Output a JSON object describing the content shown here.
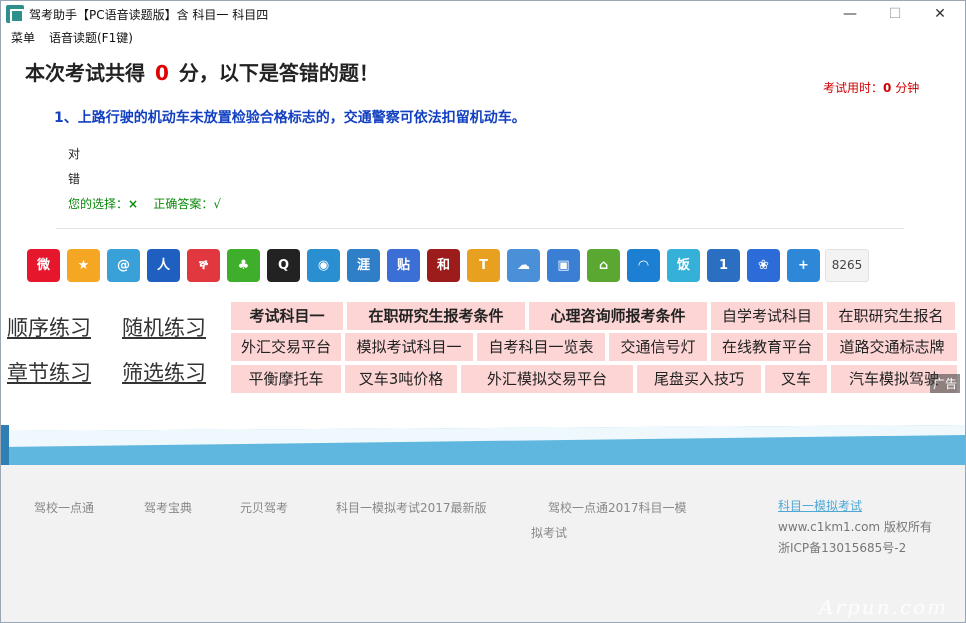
{
  "window": {
    "title": "驾考助手【PC语音读题版】含 科目一 科目四",
    "minimize": "—",
    "maximize": "☐",
    "close": "✕"
  },
  "menu": {
    "items": [
      "菜单",
      "语音读题(F1键)"
    ]
  },
  "result": {
    "heading_pre": "本次考试共得",
    "score": "0",
    "heading_post": "分，以下是答错的题！",
    "timer_label": "考试用时：",
    "timer_value": "0",
    "timer_unit": "分钟"
  },
  "question": {
    "text": "1、上路行驶的机动车未放置检验合格标志的，交通警察可依法扣留机动车。",
    "options": [
      "对",
      "错"
    ],
    "your_choice_label": "您的选择：",
    "your_choice": "×",
    "correct_label": "正确答案：",
    "correct": "√"
  },
  "share": {
    "icons": [
      {
        "name": "weibo-icon",
        "glyph": "微",
        "color": "#e6162d"
      },
      {
        "name": "qzone-icon",
        "glyph": "★",
        "color": "#f5a623"
      },
      {
        "name": "tencent-weibo-icon",
        "glyph": "@",
        "color": "#3aa0d8"
      },
      {
        "name": "renren-icon",
        "glyph": "人",
        "color": "#1f5fbf"
      },
      {
        "name": "douban-icon",
        "glyph": "ኞ",
        "color": "#e0383e"
      },
      {
        "name": "kaixin-icon",
        "glyph": "♣",
        "color": "#3fae2a"
      },
      {
        "name": "qq-icon",
        "glyph": "Q",
        "color": "#222222"
      },
      {
        "name": "tianya-icon",
        "glyph": "◉",
        "color": "#2a8fd1"
      },
      {
        "name": "sohu-icon",
        "glyph": "涯",
        "color": "#2f7fc8"
      },
      {
        "name": "tieba-icon",
        "glyph": "贴",
        "color": "#3b6fd6"
      },
      {
        "name": "hexun-icon",
        "glyph": "和",
        "color": "#9c1c1c"
      },
      {
        "name": "toutiao-icon",
        "glyph": "T",
        "color": "#e8a020"
      },
      {
        "name": "cloud-icon",
        "glyph": "☁",
        "color": "#4a90d9"
      },
      {
        "name": "gallery-icon",
        "glyph": "▣",
        "color": "#3a7fd4"
      },
      {
        "name": "house-icon",
        "glyph": "⌂",
        "color": "#5aa832"
      },
      {
        "name": "wifi-icon",
        "glyph": "◠",
        "color": "#1d7fd1"
      },
      {
        "name": "fanfou-icon",
        "glyph": "饭",
        "color": "#35b0d9"
      },
      {
        "name": "number-one-icon",
        "glyph": "1",
        "color": "#2a6fc1"
      },
      {
        "name": "paw-icon",
        "glyph": "❀",
        "color": "#2b6cd8"
      },
      {
        "name": "more-plus-icon",
        "glyph": "+",
        "color": "#2f87d8"
      }
    ],
    "count": "8265"
  },
  "practice": {
    "items": [
      "顺序练习",
      "随机练习",
      "章节练习",
      "筛选练习"
    ]
  },
  "ad_links": {
    "rows": [
      [
        "考试科目一",
        "在职研究生报考条件",
        "心理咨询师报考条件",
        "自学考试科目",
        "在职研究生报名"
      ],
      [
        "外汇交易平台",
        "模拟考试科目一",
        "自考科目一览表",
        "交通信号灯",
        "在线教育平台",
        "道路交通标志牌"
      ],
      [
        "平衡摩托车",
        "叉车3吨价格",
        "外汇模拟交易平台",
        "尾盘买入技巧",
        "叉车",
        "汽车模拟驾驶"
      ]
    ],
    "ad_tag": "广告"
  },
  "footer": {
    "links": [
      "驾校一点通",
      "驾考宝典",
      "元贝驾考",
      "科目一模拟考试2017最新版",
      "驾校一点通2017科目一模",
      "拟考试"
    ],
    "right_link": "科目一模拟考试",
    "copyright": "www.c1km1.com 版权所有",
    "icp": "浙ICP备13015685号-2",
    "watermark": "Arpun.com"
  },
  "colors": {
    "score_red": "#e00000",
    "question_blue": "#1240c0",
    "answer_green": "#0a8a0a",
    "ad_pink": "#fdd5d5",
    "wave_blue": "#5fb6de"
  }
}
